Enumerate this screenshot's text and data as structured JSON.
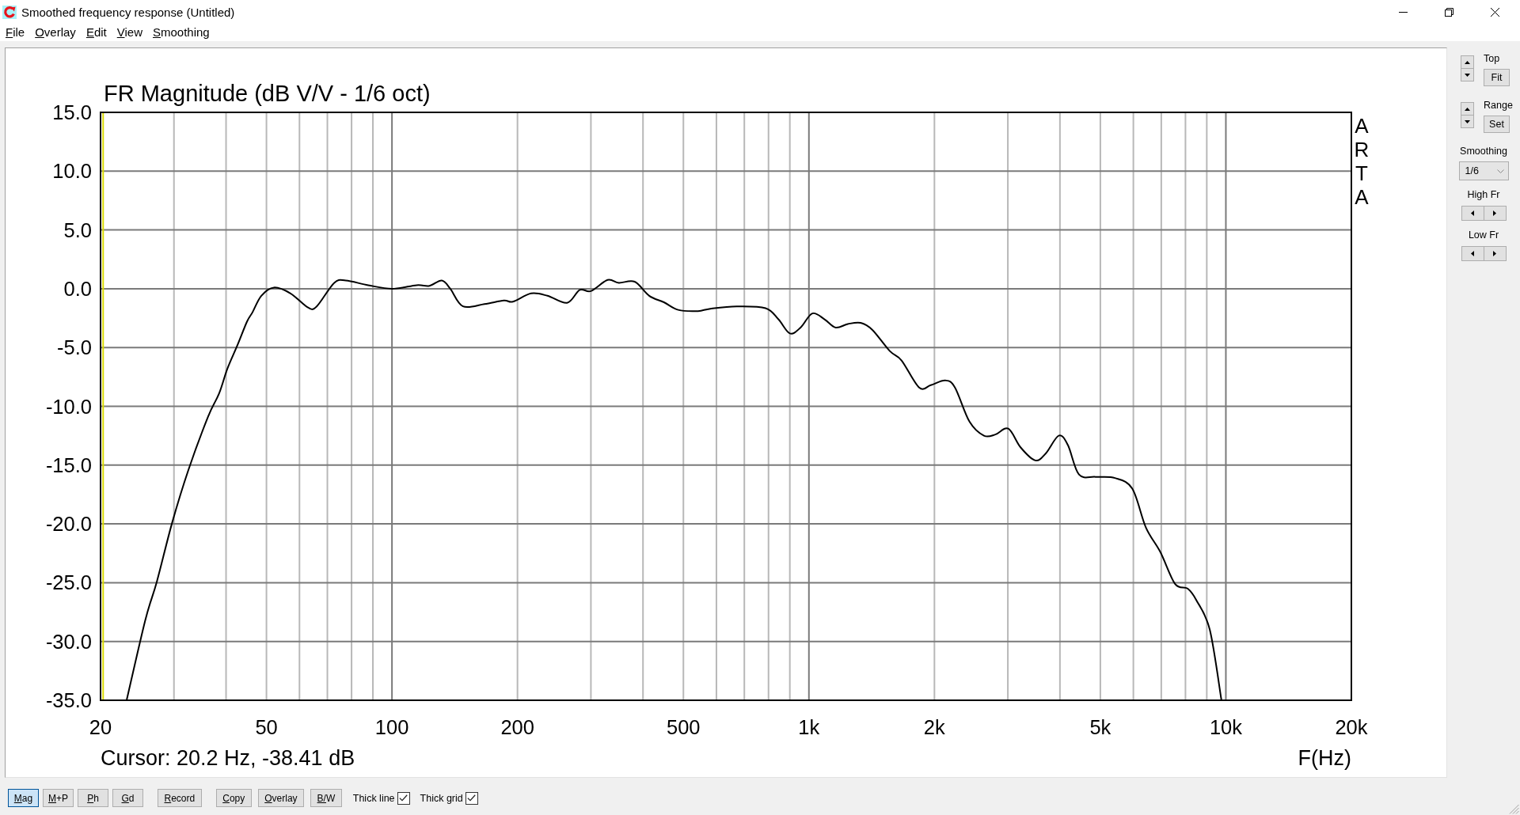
{
  "window": {
    "title": "Smoothed frequency response (Untitled)"
  },
  "menu": [
    {
      "label": "File"
    },
    {
      "label": "Overlay"
    },
    {
      "label": "Edit"
    },
    {
      "label": "View"
    },
    {
      "label": "Smoothing"
    }
  ],
  "plot": {
    "side_label": "ARTA",
    "cursor_readout": "Cursor: 20.2 Hz, -38.41 dB",
    "chart_data": {
      "type": "line",
      "title": "FR Magnitude (dB V/V - 1/6 oct)",
      "xlabel": "F(Hz)",
      "log": "x",
      "grid": true,
      "x": [
        23.1,
        25.6,
        27.3,
        29.7,
        32.5,
        36.2,
        38.5,
        40.3,
        42.6,
        44.9,
        46.3,
        48.6,
        52.1,
        57.1,
        62.9,
        66.0,
        72.7,
        77.5,
        87.7,
        100,
        114.6,
        123,
        131.7,
        138,
        148,
        166.7,
        185.5,
        195,
        215.7,
        236,
        263,
        282,
        300,
        329,
        350,
        382,
        414,
        449,
        486,
        542,
        580,
        671,
        787,
        845,
        900,
        955,
        1019,
        1090,
        1159,
        1240,
        1331,
        1420,
        1563,
        1668,
        1838,
        1960,
        2124,
        2240,
        2427,
        2629,
        2800,
        3007,
        3220,
        3491,
        3700,
        3973,
        4180,
        4443,
        4868,
        5420,
        5964,
        6429,
        6966,
        7551,
        8094,
        8500,
        9150,
        9760
      ],
      "series": [
        {
          "color": "#000000",
          "values": [
            -35.0,
            -28.2,
            -24.9,
            -19.9,
            -15.4,
            -10.9,
            -8.9,
            -6.8,
            -4.8,
            -2.8,
            -2.0,
            -0.6,
            0.1,
            -0.4,
            -1.6,
            -1.5,
            0.5,
            0.7,
            0.3,
            0.0,
            0.3,
            0.25,
            0.7,
            0.0,
            -1.5,
            -1.3,
            -1.0,
            -1.1,
            -0.4,
            -0.6,
            -1.2,
            -0.1,
            -0.2,
            0.75,
            0.5,
            0.6,
            -0.6,
            -1.15,
            -1.8,
            -1.9,
            -1.7,
            -1.5,
            -1.65,
            -2.6,
            -3.8,
            -3.3,
            -2.1,
            -2.6,
            -3.3,
            -3.0,
            -2.9,
            -3.5,
            -5.3,
            -6.1,
            -8.4,
            -8.2,
            -7.8,
            -8.4,
            -11.3,
            -12.5,
            -12.4,
            -11.9,
            -13.5,
            -14.6,
            -14.0,
            -12.5,
            -13.3,
            -15.8,
            -16.0,
            -16.1,
            -17.0,
            -20.3,
            -22.4,
            -25.1,
            -25.5,
            -26.5,
            -29.0,
            -35.0
          ]
        }
      ],
      "xlim": [
        20,
        20000
      ],
      "ylim": [
        -35,
        15
      ],
      "xticks": [
        {
          "value": 20,
          "label": "20"
        },
        {
          "value": 50,
          "label": "50"
        },
        {
          "value": 100,
          "label": "100"
        },
        {
          "value": 200,
          "label": "200"
        },
        {
          "value": 500,
          "label": "500"
        },
        {
          "value": 1000,
          "label": "1k"
        },
        {
          "value": 2000,
          "label": "2k"
        },
        {
          "value": 5000,
          "label": "5k"
        },
        {
          "value": 10000,
          "label": "10k"
        },
        {
          "value": 20000,
          "label": "20k"
        }
      ],
      "yticks": [
        {
          "value": 15,
          "label": "15.0"
        },
        {
          "value": 10,
          "label": "10.0"
        },
        {
          "value": 5,
          "label": "5.0"
        },
        {
          "value": 0,
          "label": "0.0"
        },
        {
          "value": -5,
          "label": "-5.0"
        },
        {
          "value": -10,
          "label": "-10.0"
        },
        {
          "value": -15,
          "label": "-15.0"
        },
        {
          "value": -20,
          "label": "-20.0"
        },
        {
          "value": -25,
          "label": "-25.0"
        },
        {
          "value": -30,
          "label": "-30.0"
        },
        {
          "value": -35,
          "label": "-35.0"
        }
      ],
      "ref_lines": [
        {
          "axis": "x",
          "value": 20.2,
          "color": "#d8d800"
        }
      ]
    }
  },
  "side_panel": [
    {
      "kind": "spin",
      "label": "Top",
      "button": "Fit"
    },
    {
      "kind": "spin",
      "label": "Range",
      "button": "Set"
    },
    {
      "kind": "dropdown",
      "label": "Smoothing",
      "value": "1/6"
    },
    {
      "kind": "stepper",
      "label": "High Fr"
    },
    {
      "kind": "stepper",
      "label": "Low Fr"
    }
  ],
  "toolbar": {
    "views": [
      {
        "label": "Mag",
        "selected": true
      },
      {
        "label": "M+P",
        "selected": false
      },
      {
        "label": "Ph",
        "selected": false
      },
      {
        "label": "Gd",
        "selected": false
      }
    ],
    "actions": [
      {
        "label": "Record"
      },
      {
        "label": "Copy"
      },
      {
        "label": "Overlay"
      },
      {
        "label": "B/W"
      }
    ],
    "checkboxes": [
      {
        "label": "Thick line",
        "checked": true
      },
      {
        "label": "Thick grid",
        "checked": true
      }
    ]
  }
}
